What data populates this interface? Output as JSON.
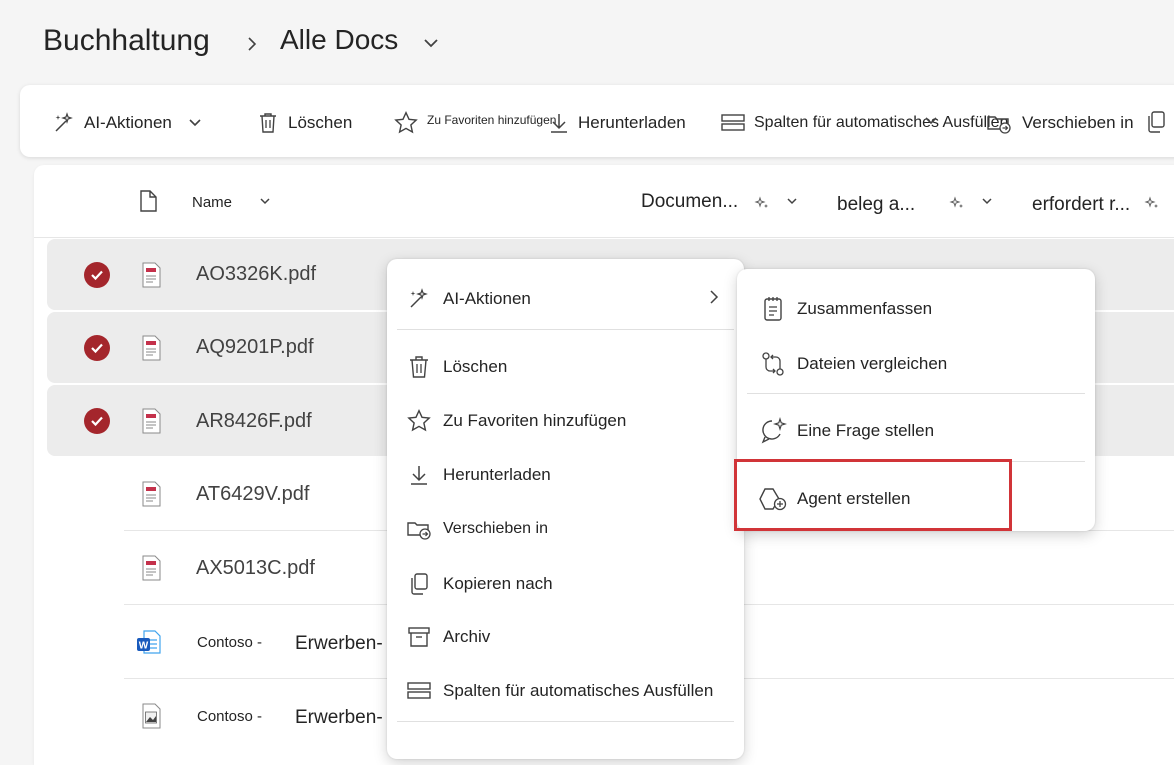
{
  "breadcrumb": {
    "root": "Buchhaltung",
    "separator": "›",
    "current": "Alle Docs"
  },
  "toolbar": {
    "ai_actions": "AI-Aktionen",
    "delete": "Löschen",
    "favorite": "Zu Favoriten hinzufügen",
    "download": "Herunterladen",
    "autofill": "Spalten für automatisches Ausfüllen",
    "move": "Verschieben in"
  },
  "columns": {
    "name": "Name",
    "col2": "Documen...",
    "col3": "beleg a...",
    "col4": "erfordert r..."
  },
  "files": [
    {
      "name": "AO3326K.pdf",
      "selected": true,
      "type": "pdf"
    },
    {
      "name": "AQ9201P.pdf",
      "selected": true,
      "type": "pdf"
    },
    {
      "name": "AR8426F.pdf",
      "selected": true,
      "type": "pdf"
    },
    {
      "name": "AT6429V.pdf",
      "selected": false,
      "type": "pdf"
    },
    {
      "name": "AX5013C.pdf",
      "selected": false,
      "type": "pdf"
    },
    {
      "name": "Contoso -",
      "name2": "Erwerben-",
      "selected": false,
      "type": "word"
    },
    {
      "name": "Contoso -",
      "name2": "Erwerben-",
      "selected": false,
      "type": "image"
    }
  ],
  "context_menu": {
    "ai_actions": "AI-Aktionen",
    "delete": "Löschen",
    "favorite": "Zu Favoriten hinzufügen",
    "download": "Herunterladen",
    "move": "Verschieben in",
    "copy": "Kopieren nach",
    "archive": "Archiv",
    "autofill": "Spalten für automatisches Ausfüllen"
  },
  "submenu": {
    "summarize": "Zusammenfassen",
    "compare": "Dateien vergleichen",
    "ask": "Eine Frage stellen",
    "create_agent": "Agent erstellen"
  },
  "colors": {
    "selected_check": "#a4262c",
    "highlight_box": "#d13438",
    "pdf_red": "#c4314b",
    "word_blue": "#185abd"
  }
}
